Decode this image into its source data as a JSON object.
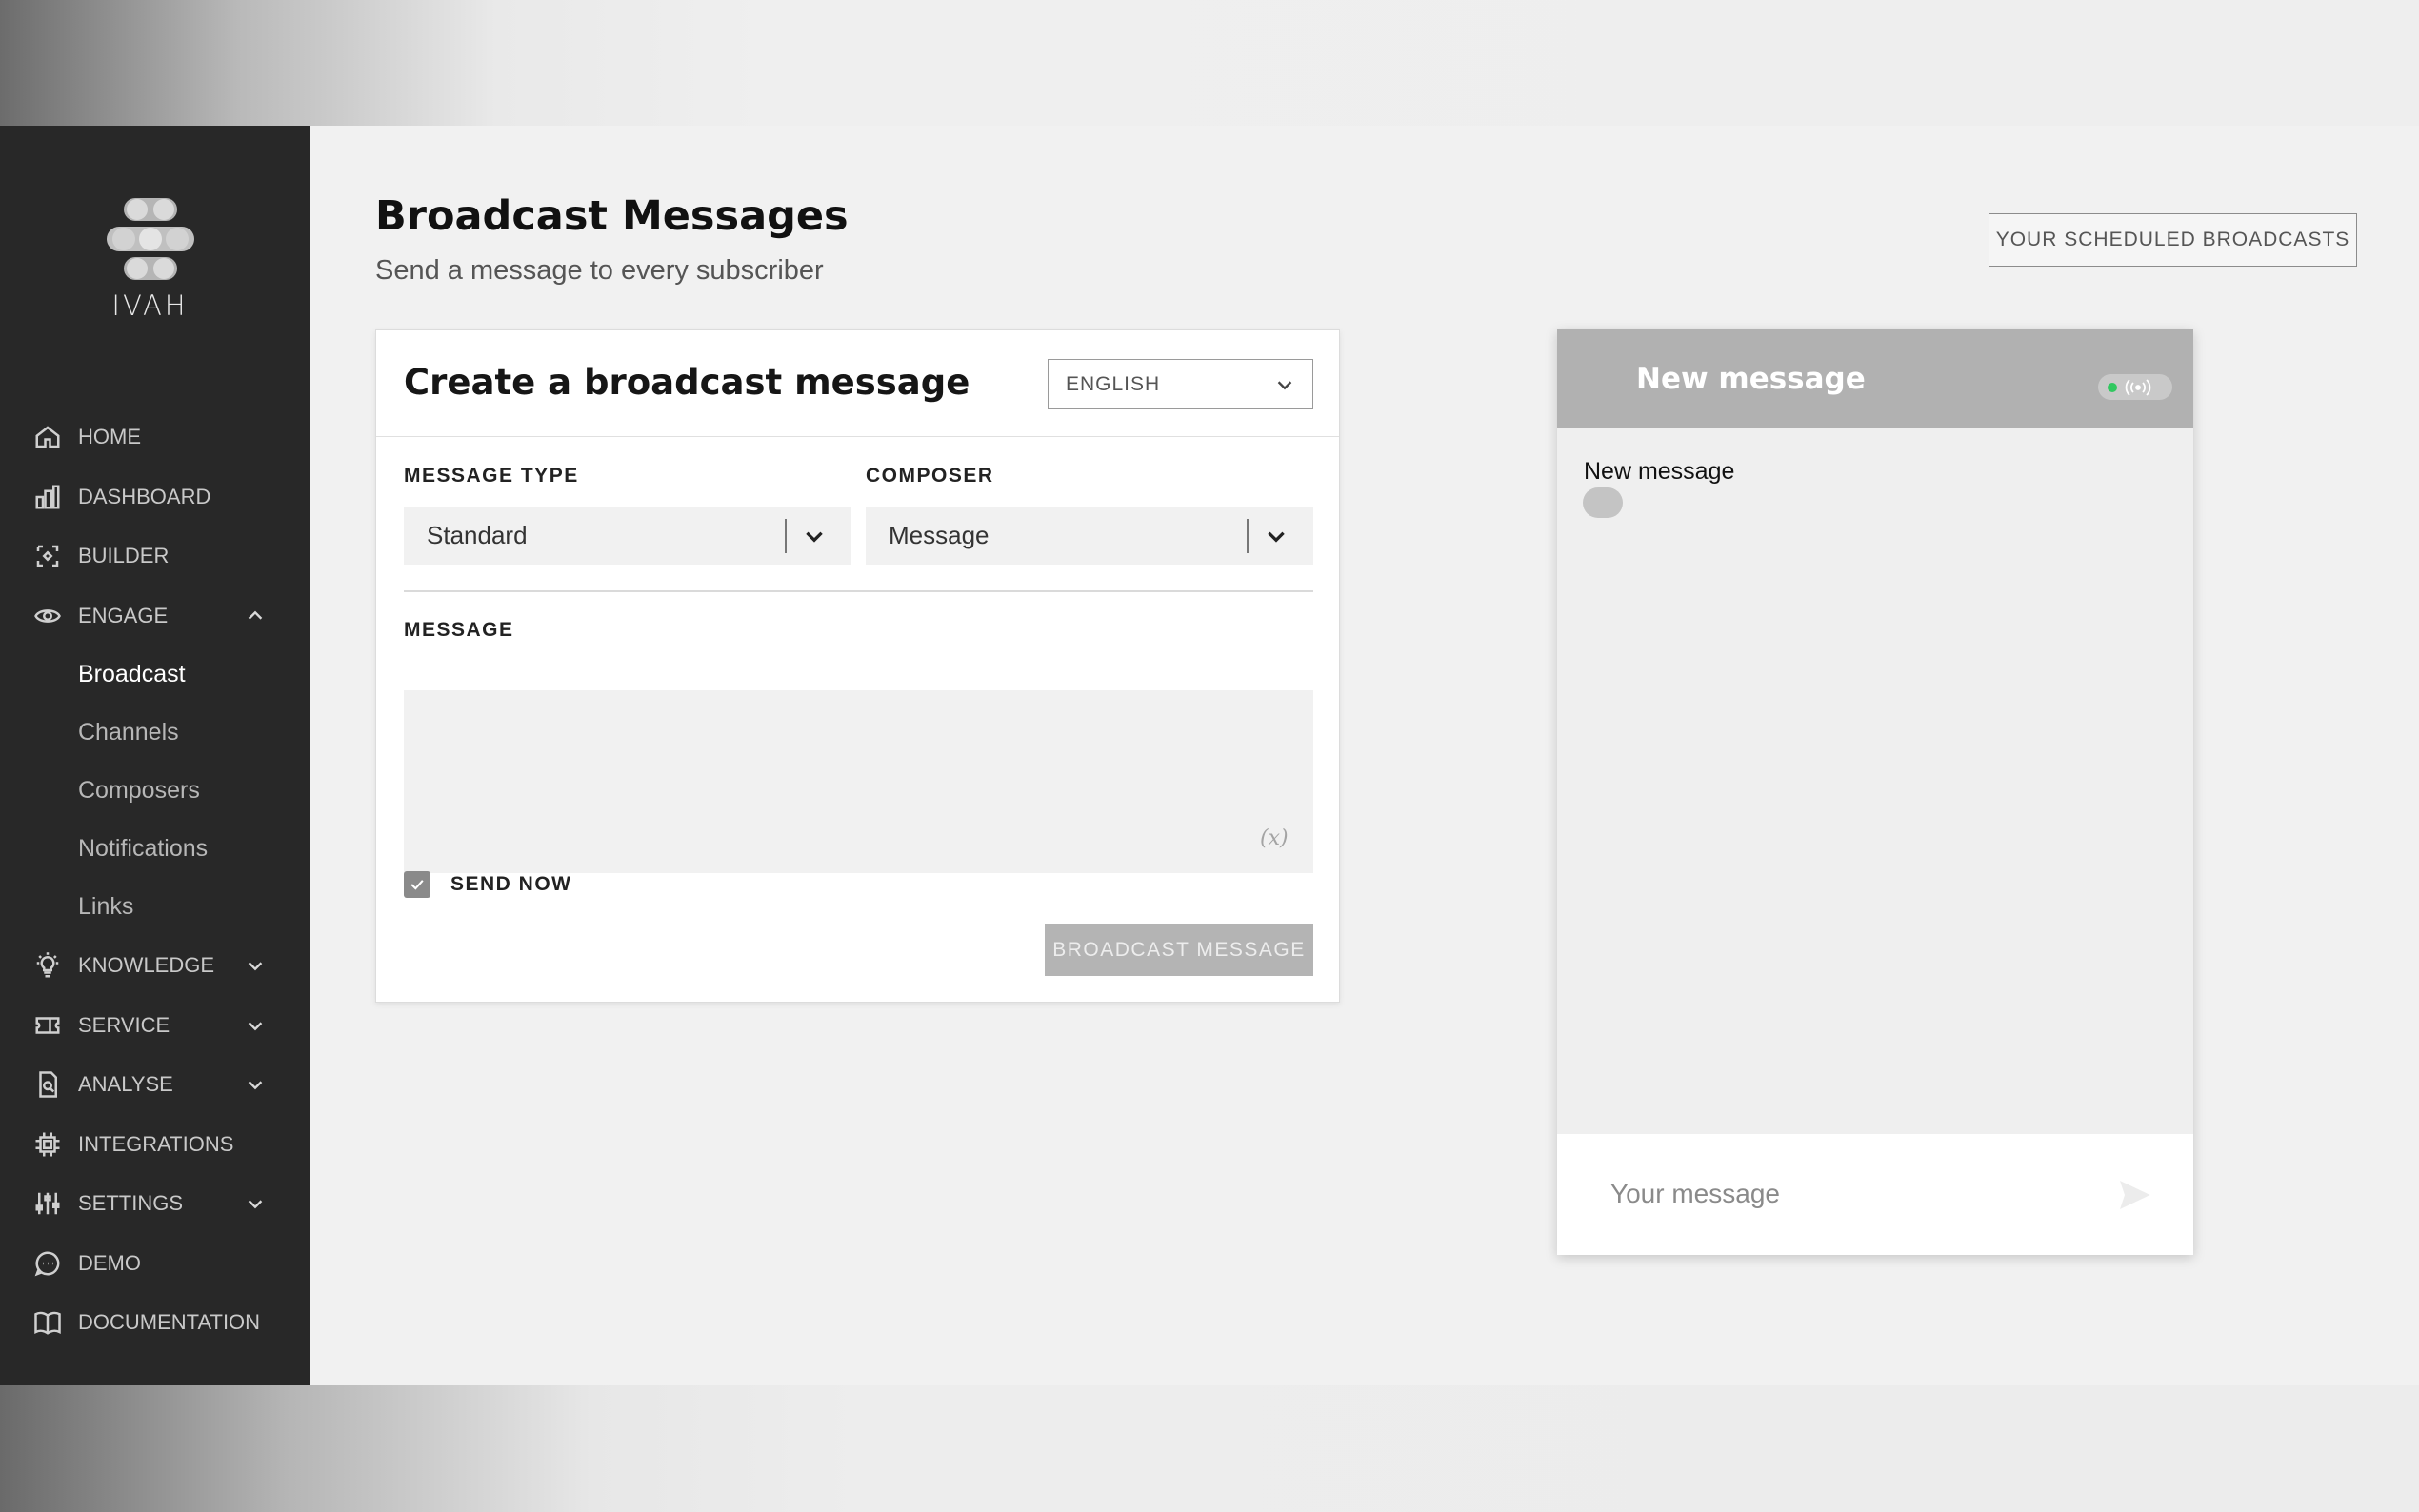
{
  "brand": {
    "name": "IVAH"
  },
  "sidebar": {
    "items": [
      {
        "label": "HOME",
        "icon": "home-icon"
      },
      {
        "label": "DASHBOARD",
        "icon": "bar-chart-icon"
      },
      {
        "label": "BUILDER",
        "icon": "builder-icon"
      },
      {
        "label": "ENGAGE",
        "icon": "eye-icon",
        "expanded": true,
        "children": [
          "Broadcast",
          "Channels",
          "Composers",
          "Notifications",
          "Links"
        ],
        "active_child": "Broadcast"
      },
      {
        "label": "KNOWLEDGE",
        "icon": "lightbulb-icon"
      },
      {
        "label": "SERVICE",
        "icon": "ticket-icon"
      },
      {
        "label": "ANALYSE",
        "icon": "document-search-icon"
      },
      {
        "label": "INTEGRATIONS",
        "icon": "chip-icon"
      },
      {
        "label": "SETTINGS",
        "icon": "sliders-icon"
      },
      {
        "label": "DEMO",
        "icon": "chat-bubble-icon"
      },
      {
        "label": "DOCUMENTATION",
        "icon": "book-icon"
      }
    ]
  },
  "page": {
    "title": "Broadcast Messages",
    "subtitle": "Send a message to every subscriber",
    "scheduled_button": "YOUR SCHEDULED BROADCASTS"
  },
  "form": {
    "title": "Create a broadcast message",
    "language": "ENGLISH",
    "message_type_label": "MESSAGE TYPE",
    "message_type_value": "Standard",
    "composer_label": "COMPOSER",
    "composer_value": "Message",
    "message_label": "MESSAGE",
    "message_value": "",
    "variable_icon": "(x)",
    "send_now_label": "SEND NOW",
    "send_now_checked": true,
    "submit_label": "BROADCAST MESSAGE"
  },
  "preview": {
    "header_title": "New message",
    "status_color": "#31c860",
    "message_text": "New message",
    "input_placeholder": "Your message"
  }
}
